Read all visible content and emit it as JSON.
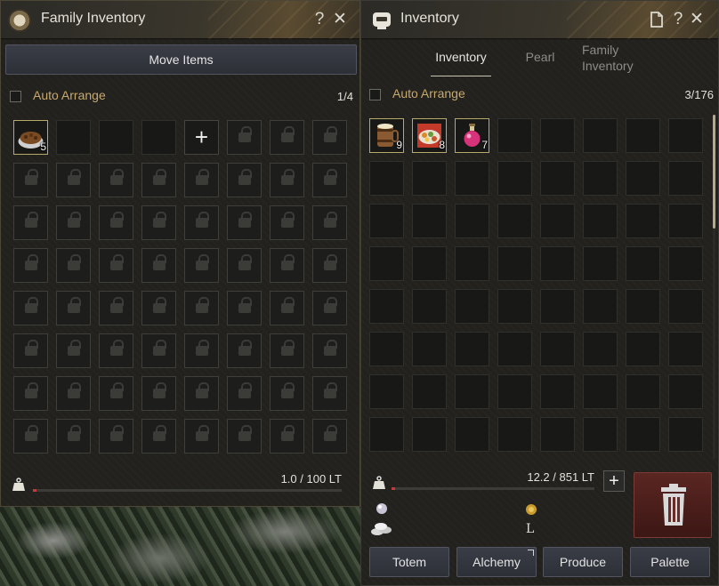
{
  "family_window": {
    "title": "Family Inventory",
    "help_label": "?",
    "close_label": "✕",
    "move_items_label": "Move Items",
    "auto_arrange_label": "Auto Arrange",
    "slot_count": "1/4",
    "items": [
      {
        "name": "pet-feed-icon",
        "qty": "5"
      }
    ],
    "add_slot_label": "+",
    "weight_text": "1.0 / 100 LT",
    "weight_fraction": 0.01
  },
  "inventory_window": {
    "title": "Inventory",
    "help_label": "?",
    "close_label": "✕",
    "tabs": [
      {
        "label": "Inventory",
        "active": true
      },
      {
        "label": "Pearl",
        "active": false
      },
      {
        "label": "Family\nInventory",
        "active": false
      }
    ],
    "auto_arrange_label": "Auto Arrange",
    "slot_count": "3/176",
    "items": [
      {
        "name": "beer-keg-icon",
        "qty": "9"
      },
      {
        "name": "meal-platter-icon",
        "qty": "8"
      },
      {
        "name": "elixir-potion-icon",
        "qty": "7"
      }
    ],
    "weight_text": "12.2 / 851 LT",
    "weight_fraction": 0.014,
    "expand_weight_label": "+",
    "currency_silver_letter": "L",
    "buttons": [
      {
        "label": "Totem"
      },
      {
        "label": "Alchemy"
      },
      {
        "label": "Produce"
      },
      {
        "label": "Palette"
      }
    ]
  },
  "colors": {
    "accent_gold": "#c7a96e",
    "weight_fill": "#c23b3b",
    "trash_red": "#5a2622"
  }
}
